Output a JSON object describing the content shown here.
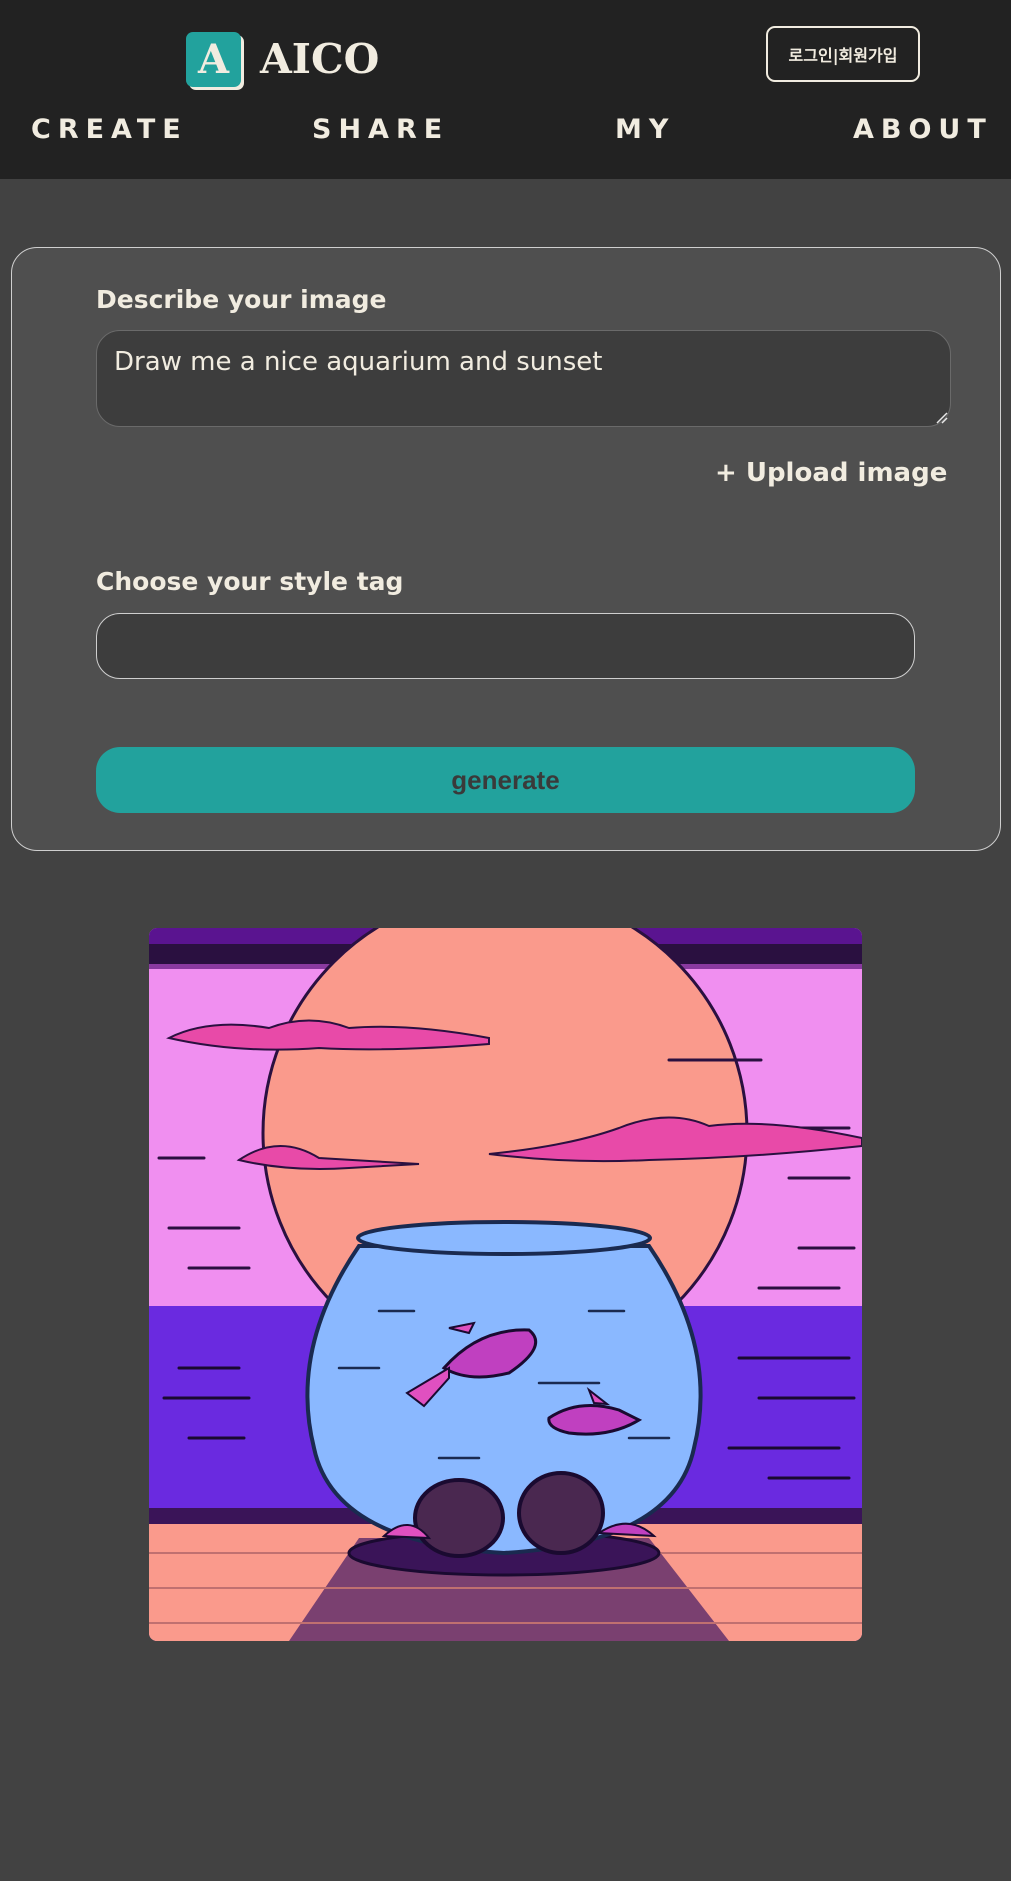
{
  "brand": {
    "mark": "A",
    "name": "AICO"
  },
  "auth": {
    "label": "로그인|회원가입"
  },
  "nav": {
    "items": [
      {
        "label": "CREATE"
      },
      {
        "label": "SHARE"
      },
      {
        "label": "MY"
      },
      {
        "label": "ABOUT"
      }
    ]
  },
  "form": {
    "describe_label": "Describe your image",
    "prompt_value": "Draw me a nice aquarium and sunset",
    "upload_label": "+ Upload image",
    "style_label": "Choose your style tag",
    "style_value": "",
    "generate_label": "generate"
  },
  "colors": {
    "accent": "#22a29d",
    "header_bg": "#222222",
    "page_bg": "#424242",
    "card_bg": "#4f4f4f",
    "text": "#f1ece0"
  }
}
